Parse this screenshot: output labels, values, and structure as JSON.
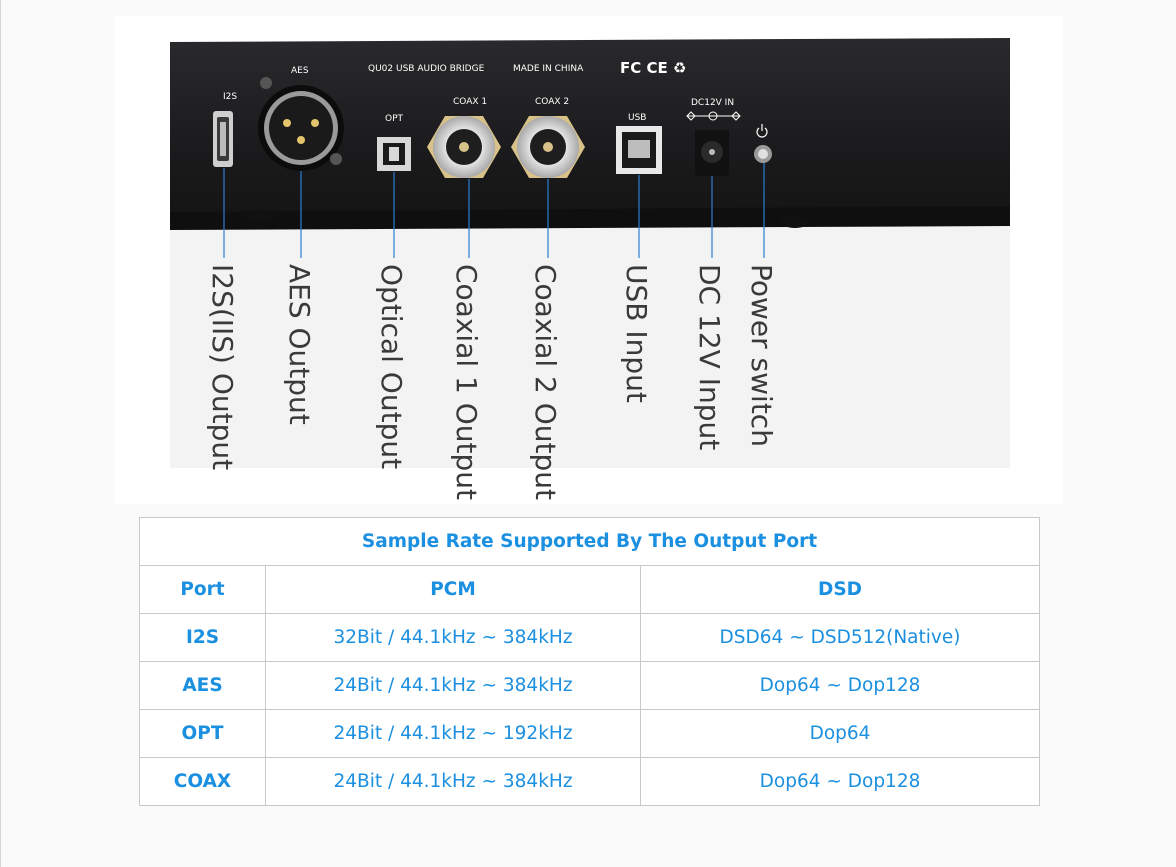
{
  "device": {
    "panel_labels": {
      "i2s": "I2S",
      "aes": "AES",
      "title": "QU02 USB AUDIO BRIDGE",
      "origin": "MADE IN CHINA",
      "opt": "OPT",
      "coax1": "COAX 1",
      "coax2": "COAX 2",
      "usb": "USB",
      "dc": "DC12V IN"
    },
    "callouts": [
      "I2S(IIS) Output",
      "AES Output",
      "Optical Output",
      "Coaxial 1 Output",
      "Coaxial 2 Output",
      "USB Input",
      "DC 12V Input",
      "Power switch"
    ]
  },
  "table": {
    "title": "Sample Rate Supported By The Output Port",
    "headers": [
      "Port",
      "PCM",
      "DSD"
    ],
    "rows": [
      {
        "port": "I2S",
        "pcm": "32Bit / 44.1kHz ~ 384kHz",
        "dsd": "DSD64 ~ DSD512(Native)"
      },
      {
        "port": "AES",
        "pcm": "24Bit / 44.1kHz ~ 384kHz",
        "dsd": "Dop64 ~ Dop128"
      },
      {
        "port": "OPT",
        "pcm": "24Bit / 44.1kHz ~ 192kHz",
        "dsd": "Dop64"
      },
      {
        "port": "COAX",
        "pcm": "24Bit / 44.1kHz ~ 384kHz",
        "dsd": "Dop64 ~ Dop128"
      }
    ]
  },
  "colors": {
    "accent": "#1b8fe0",
    "callout_line": "#2a7fd0",
    "panel": "#1c1c1e"
  }
}
